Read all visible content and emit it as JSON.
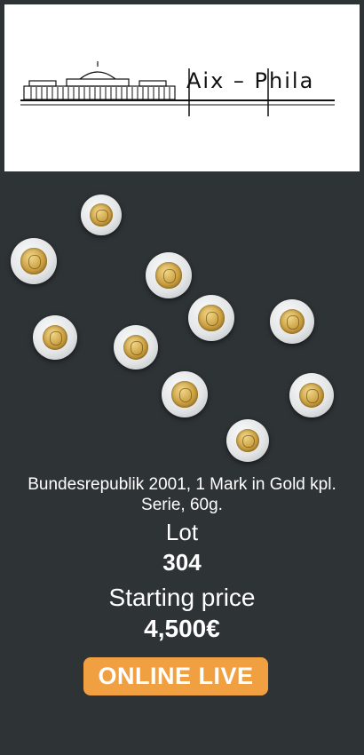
{
  "logo": {
    "text": "Aix – Phila"
  },
  "lot": {
    "title": "Bundesrepublik 2001, 1 Mark in Gold kpl. Serie, 60g.",
    "label": "Lot",
    "number": "304"
  },
  "price": {
    "label": "Starting price",
    "value": "4,500€"
  },
  "cta": {
    "label": "ONLINE LIVE"
  },
  "colors": {
    "background": "#2e3336",
    "accent": "#f0a040",
    "text": "#ffffff"
  }
}
